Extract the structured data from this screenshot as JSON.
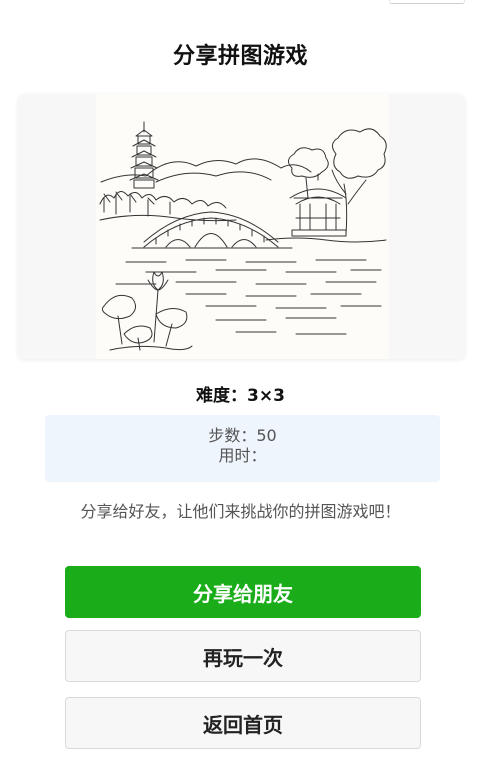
{
  "header": {
    "title": "分享拼图游戏"
  },
  "puzzle_image": {
    "subject": "line-art landscape with pagoda, arched bridge, pavilion, trees and lotus pond"
  },
  "result": {
    "difficulty": "难度：3×3",
    "steps": "步数：50",
    "time": "用时："
  },
  "share_prompt": "分享给好友，让他们来挑战你的拼图游戏吧！",
  "buttons": {
    "share": "分享给朋友",
    "replay": "再玩一次",
    "home": "返回首页"
  },
  "colors": {
    "primary_green": "#1aad19",
    "stats_background": "#eef5fd",
    "secondary_button_background": "#f7f7f7"
  }
}
